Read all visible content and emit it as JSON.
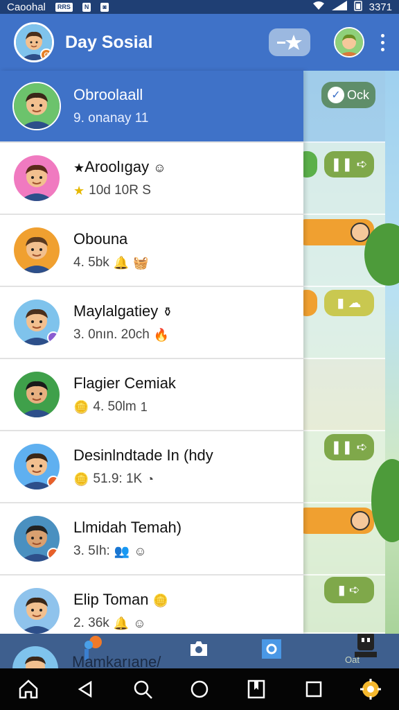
{
  "status_bar": {
    "carrier": "Caoohal",
    "time": "3371",
    "icon1_text": "RRS",
    "icon2_text": "",
    "icon3_text": ""
  },
  "header": {
    "title": "Day Sosial",
    "pin_icon": "pin-star-icon",
    "more_icon": "more-vert-icon"
  },
  "chats": [
    {
      "name": "Obroolaall",
      "meta": "9. onanay 11",
      "meta_icons": [],
      "name_emoji": "",
      "active": true,
      "badge": ""
    },
    {
      "name": "Aroolıgay",
      "meta": "10d 10R S",
      "meta_icons": [
        "star"
      ],
      "name_emoji": "face",
      "active": false,
      "badge": ""
    },
    {
      "name": "Obouna",
      "meta": "4. 5bk",
      "meta_icons": [
        "bell",
        "basket"
      ],
      "name_emoji": "",
      "active": false,
      "badge": ""
    },
    {
      "name": "Maylalgatiey",
      "meta": "3. 0nın. 20ch",
      "meta_icons": [
        "flame"
      ],
      "name_emoji": "jar",
      "active": false,
      "badge": "purple"
    },
    {
      "name": "Flagier Cemiak",
      "meta": "4. 50lm",
      "meta_icons": [
        "coin",
        "1"
      ],
      "name_emoji": "",
      "active": false,
      "badge": ""
    },
    {
      "name": "Desinlndtade In (hdy",
      "meta": "51.9: 1K",
      "meta_icons": [
        "coin",
        "clock"
      ],
      "name_emoji": "",
      "active": false,
      "badge": "orange"
    },
    {
      "name": "Llmidah Temah)",
      "meta": "3. 5Ih:",
      "meta_icons": [
        "people",
        "smile"
      ],
      "name_emoji": "",
      "active": false,
      "badge": "orange"
    },
    {
      "name": "Elip Toman",
      "meta": "2. 36k",
      "meta_icons": [
        "bell",
        "smile"
      ],
      "name_emoji": "coin",
      "active": false,
      "badge": ""
    }
  ],
  "game": {
    "pill_top": "Ock",
    "pill_bottom": "Oat"
  },
  "tabbar": {
    "peek_name": "Mamkarıane/"
  },
  "colors": {
    "header": "#3f72c8",
    "status": "#1f3f74",
    "green_pill": "#7fa84a",
    "orange_pill": "#f0a030"
  }
}
